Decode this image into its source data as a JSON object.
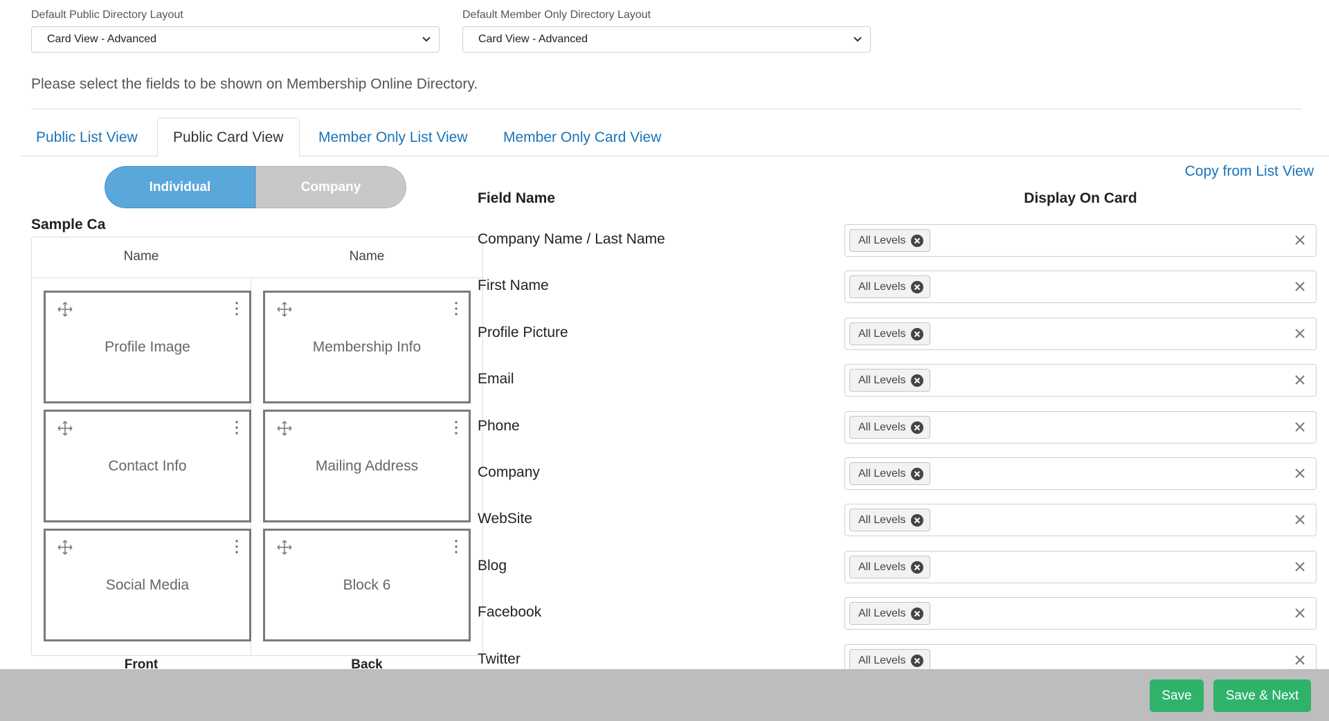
{
  "layout_settings": {
    "public_label": "Default Public Directory Layout",
    "public_value": "Card View - Advanced",
    "member_label": "Default Member Only Directory Layout",
    "member_value": "Card View - Advanced"
  },
  "hint": "Please select the fields to be shown on Membership Online Directory.",
  "tabs": [
    {
      "label": "Public List View",
      "active": false
    },
    {
      "label": "Public Card View",
      "active": true
    },
    {
      "label": "Member Only List View",
      "active": false
    },
    {
      "label": "Member Only Card View",
      "active": false
    }
  ],
  "toggle": {
    "individual": "Individual",
    "company": "Company"
  },
  "sample": {
    "title": "Sample Ca",
    "front_head": "Name",
    "back_head": "Name",
    "blocks": [
      "Profile Image",
      "Membership Info",
      "Contact Info",
      "Mailing Address",
      "Social Media",
      "Block 6"
    ],
    "front_label": "Front",
    "back_label": "Back"
  },
  "fields": {
    "copy_link": "Copy from List View",
    "header_name": "Field Name",
    "header_display": "Display On Card",
    "rows": [
      {
        "name": "Company Name / Last Name",
        "level": "All Levels"
      },
      {
        "name": "First Name",
        "level": "All Levels"
      },
      {
        "name": "Profile Picture",
        "level": "All Levels"
      },
      {
        "name": "Email",
        "level": "All Levels"
      },
      {
        "name": "Phone",
        "level": "All Levels"
      },
      {
        "name": "Company",
        "level": "All Levels"
      },
      {
        "name": "WebSite",
        "level": "All Levels"
      },
      {
        "name": "Blog",
        "level": "All Levels"
      },
      {
        "name": "Facebook",
        "level": "All Levels"
      },
      {
        "name": "Twitter",
        "level": "All Levels"
      }
    ]
  },
  "footer": {
    "save": "Save",
    "save_next": "Save & Next"
  },
  "colors": {
    "accent": "#1a73b8",
    "toggle_active": "#5aa7db",
    "save_green": "#2fb36b",
    "footer_bg": "#bdbdbd"
  },
  "icons": [
    "chevron-down-icon",
    "move-icon",
    "kebab-icon",
    "close-circle-icon",
    "close-icon"
  ]
}
